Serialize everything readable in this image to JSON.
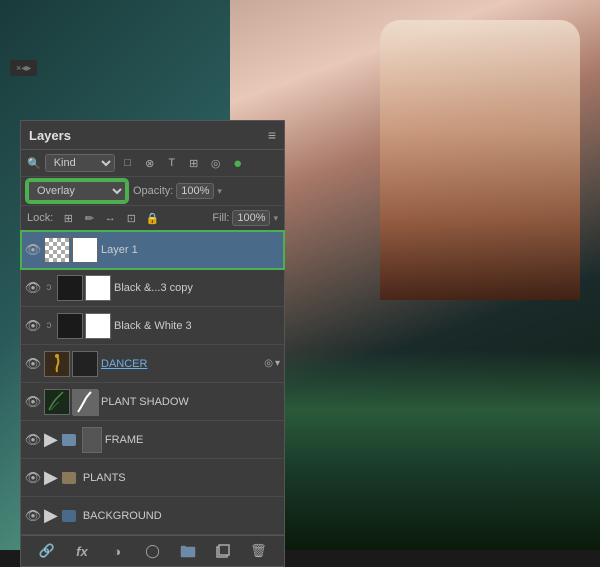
{
  "panel": {
    "title": "Layers",
    "menu_icon": "≡",
    "close_icon": "×",
    "drag_arrows": "◂▸"
  },
  "filter": {
    "label": "Kind",
    "search_icon": "🔍",
    "icons": [
      "□",
      "⊗",
      "T",
      "⊞",
      "◎"
    ]
  },
  "blend": {
    "mode": "Overlay",
    "opacity_label": "Opacity:",
    "opacity_value": "100%",
    "opacity_arrow": "▾"
  },
  "lock": {
    "label": "Lock:",
    "icons": [
      "⊞",
      "✏",
      "↔",
      "⊡",
      "🔒"
    ],
    "fill_label": "Fill:",
    "fill_value": "100%",
    "fill_arrow": "▾"
  },
  "layers": [
    {
      "id": "layer1",
      "name": "Layer 1",
      "visible": true,
      "selected": true,
      "thumb_type": "checker",
      "has_mask": true,
      "indent": 0,
      "is_folder": false,
      "has_link": false
    },
    {
      "id": "black3copy",
      "name": "Black &...3 copy",
      "visible": true,
      "selected": false,
      "thumb_type": "dark",
      "has_mask": true,
      "indent": 1,
      "is_folder": false,
      "has_link": true
    },
    {
      "id": "black3",
      "name": "Black & White 3",
      "visible": true,
      "selected": false,
      "thumb_type": "dark",
      "has_mask": true,
      "indent": 1,
      "is_folder": false,
      "has_link": true
    },
    {
      "id": "dancer",
      "name": "DANCER",
      "visible": true,
      "selected": false,
      "thumb_type": "dancer",
      "has_mask": true,
      "indent": 0,
      "is_folder": false,
      "has_link": false,
      "underline": true,
      "has_badge": true,
      "badge_icon": "◎",
      "badge_arrow": "▾"
    },
    {
      "id": "plant_shadow",
      "name": "PLANT SHADOW",
      "visible": true,
      "selected": false,
      "thumb_type": "plant",
      "has_mask": true,
      "indent": 0,
      "is_folder": false,
      "has_link": false
    },
    {
      "id": "frame",
      "name": "FRAME",
      "visible": true,
      "selected": false,
      "thumb_type": "frame",
      "has_mask": false,
      "indent": 0,
      "is_folder": true,
      "has_link": false,
      "folder_color": "#6a8aaa"
    },
    {
      "id": "plants",
      "name": "PLANTS",
      "visible": true,
      "selected": false,
      "thumb_type": "plants_folder",
      "has_mask": false,
      "indent": 0,
      "is_folder": true,
      "has_link": false,
      "folder_color": "#8a6a4a"
    },
    {
      "id": "background",
      "name": "BACKGROUND",
      "visible": true,
      "selected": false,
      "thumb_type": "dark",
      "has_mask": false,
      "indent": 0,
      "is_folder": true,
      "has_link": false,
      "folder_color": "#4a6a8a"
    }
  ],
  "footer": {
    "link_icon": "🔗",
    "fx_label": "fx",
    "circle_icon": "◑",
    "mask_icon": "◯",
    "folder_icon": "📁",
    "new_icon": "📄",
    "trash_icon": "🗑"
  }
}
